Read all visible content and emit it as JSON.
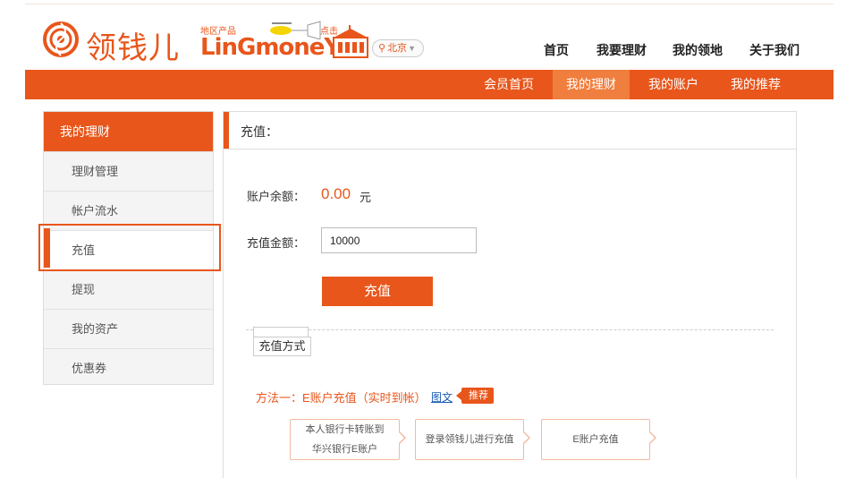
{
  "header": {
    "logo_cn": "领钱儿",
    "logo_en": "LinGmoneY",
    "promo_left": "地区产品",
    "promo_right": "点击",
    "city": "北京"
  },
  "top_nav": [
    {
      "label": "首页"
    },
    {
      "label": "我要理财"
    },
    {
      "label": "我的领地"
    },
    {
      "label": "关于我们"
    }
  ],
  "orange_nav": [
    {
      "label": "会员首页",
      "active": false
    },
    {
      "label": "我的理财",
      "active": true
    },
    {
      "label": "我的账户",
      "active": false
    },
    {
      "label": "我的推荐",
      "active": false
    }
  ],
  "sidebar": {
    "title": "我的理财",
    "items": [
      {
        "label": "理财管理",
        "active": false
      },
      {
        "label": "帐户流水",
        "active": false
      },
      {
        "label": "充值",
        "active": true
      },
      {
        "label": "提现",
        "active": false
      },
      {
        "label": "我的资产",
        "active": false
      },
      {
        "label": "优惠券",
        "active": false
      }
    ]
  },
  "main": {
    "title": "充值：",
    "balance_label": "账户余额：",
    "balance_value": "0.00",
    "balance_unit": "元",
    "amount_label": "充值金额：",
    "amount_value": "10000",
    "submit_label": "充值",
    "method_tab": "充值方式",
    "method_title": "方法一：E账户充值（实时到帐）",
    "method_link": "图文",
    "recommend_badge": "推荐",
    "steps": [
      {
        "line1": "本人银行卡转账到",
        "line2": "华兴银行E账户"
      },
      {
        "line1": "登录领钱儿进行充值",
        "line2": ""
      },
      {
        "line1": "E账户充值",
        "line2": ""
      }
    ]
  },
  "colors": {
    "brand": "#e8561b",
    "brand_light": "#f07e3e",
    "link": "#1a5bb8"
  }
}
